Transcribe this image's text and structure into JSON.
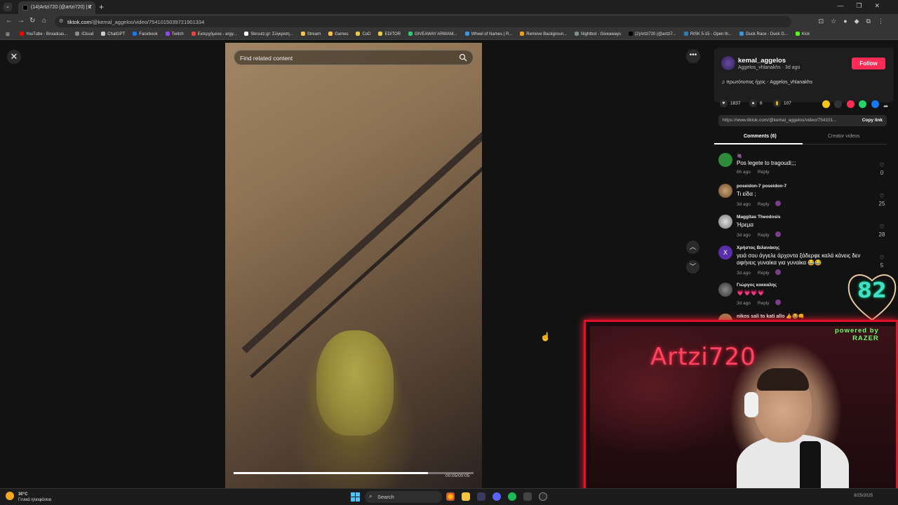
{
  "browser": {
    "tab_title": "(14)Artzi720 (@artzi720) | T",
    "url_host": "tiktok.com",
    "url_path": "/@kemal_aggelos/video/7541015039721901334",
    "bookmarks": [
      {
        "label": "YouTube - Broadcas...",
        "color": "#ff0000"
      },
      {
        "label": "iCloud",
        "color": "#888888"
      },
      {
        "label": "ChatGPT",
        "color": "#cccccc"
      },
      {
        "label": "Facebook",
        "color": "#1877f2"
      },
      {
        "label": "Twitch",
        "color": "#9146ff"
      },
      {
        "label": "Εισερχόμενα - argy...",
        "color": "#ea4335"
      },
      {
        "label": "Skroutz.gr: Σύγκριση...",
        "color": "#ffffff"
      },
      {
        "label": "Stream",
        "color": "#f5c542"
      },
      {
        "label": "Games",
        "color": "#f5c542"
      },
      {
        "label": "CoD",
        "color": "#f5c542"
      },
      {
        "label": "EDITOR",
        "color": "#f5c542"
      },
      {
        "label": "GIVEAWAY ARMANI...",
        "color": "#2ecc71"
      },
      {
        "label": "Wheel of Names | R...",
        "color": "#3498db"
      },
      {
        "label": "Remove Backgroun...",
        "color": "#f39c12"
      },
      {
        "label": "Nightbot - Giveaways",
        "color": "#7f8c8d"
      },
      {
        "label": "(2)Artzi720 (@artzi7...",
        "color": "#000000"
      },
      {
        "label": "RISK 5-15 - Open th...",
        "color": "#2980b9"
      },
      {
        "label": "Duck Race - Duck G...",
        "color": "#3498db"
      },
      {
        "label": "Kick",
        "color": "#53fc18"
      }
    ]
  },
  "video": {
    "search_placeholder": "Find related content",
    "time": "00:05/00:05",
    "progress": 0.81
  },
  "author": {
    "username": "kemal_aggelos",
    "subline": "Aggelos_vhlanakhs · 3d ago",
    "follow_label": "Follow",
    "sound": "πρωτότυπος ήχος - Aggelos_vhlanakhs"
  },
  "stats": {
    "likes": "1837",
    "comments": "6",
    "saves": "107"
  },
  "link": {
    "url": "https://www.tiktok.com/@kemal_aggelos/video/754101...",
    "copy_label": "Copy link"
  },
  "panel_tabs": {
    "comments": "Comments (6)",
    "creator": "Creator videos"
  },
  "comments": [
    {
      "user": "🍇",
      "text": "Pos legete to tragoudi;;;",
      "time": "6h ago",
      "likes": "0",
      "avatar_color": "#2e8b3a",
      "liked_by_creator": false
    },
    {
      "user": "poseidon-7 poseidon-7",
      "text": "Τι είδα ;",
      "time": "3d ago",
      "likes": "25",
      "avatar_color": "#8b6b4a",
      "liked_by_creator": true
    },
    {
      "user": "Maggitas Theodosis",
      "text": "Ήρεμα",
      "time": "3d ago",
      "likes": "28",
      "avatar_color": "#aaaaaa",
      "liked_by_creator": true
    },
    {
      "user": "Χρήστος Βιλανάκης",
      "text": "γειά σου άγγελε άρχοντα ξάδερφε καλά κάνεις δεν αφήνεις γυναίκα για γυναίκα 😂😂",
      "time": "3d ago",
      "likes": "5",
      "avatar_color": "#5a2eaa",
      "avatar_letter": "X",
      "liked_by_creator": true
    },
    {
      "user": "Γιώργος κοκκαλης",
      "text": "💗💗💗💗",
      "time": "3d ago",
      "likes": "",
      "avatar_color": "#555555",
      "liked_by_creator": true
    },
    {
      "user": "nikos sali to kati allo 👍😂👊",
      "text": "",
      "time": "",
      "likes": "",
      "avatar_color": "#a08050",
      "liked_by_creator": false
    }
  ],
  "overlay": {
    "cam_title": "Artzi720",
    "razer_line1": "powered by",
    "razer_line2": "RAZER",
    "heart_number": "82"
  },
  "taskbar": {
    "weather_temp": "30°C",
    "weather_desc": "Γενικά ηλιοφάνεια",
    "search_label": "Search",
    "date": "8/25/2025"
  },
  "colors": {
    "accent": "#fe2c55",
    "overlay_red": "#e0102a"
  }
}
